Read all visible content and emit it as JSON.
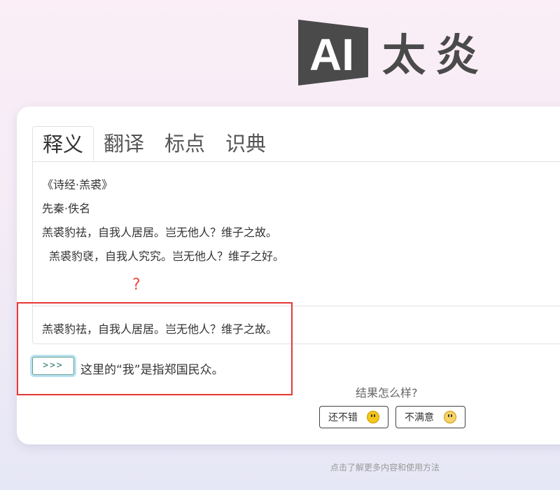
{
  "logo": {
    "latin": "AI",
    "han": [
      "太",
      "炎"
    ]
  },
  "tabs": [
    {
      "label": "释义",
      "active": true
    },
    {
      "label": "翻译",
      "active": false
    },
    {
      "label": "标点",
      "active": false
    },
    {
      "label": "识典",
      "active": false
    }
  ],
  "passage": {
    "title": "《诗经·羔裘》",
    "author": "先秦·佚名",
    "lines": [
      "羔裘豹祛，自我人居居。岂无他人？维子之故。",
      "羔裘豹褎，自我人究究。岂无他人？维子之好。"
    ]
  },
  "query_marker": "?",
  "selected_text": "羔裘豹祛，自我人居居。岂无他人？维子之故。",
  "submit_label": ">>>",
  "answer": "这里的“我”是指郑国民众。",
  "feedback": {
    "question": "结果怎么样?",
    "good_label": "还不错",
    "bad_label": "不满意"
  },
  "footer_link": "点击了解更多内容和使用方法",
  "colors": {
    "highlight_box": "#e53935",
    "accent": "#2e7d6b"
  }
}
